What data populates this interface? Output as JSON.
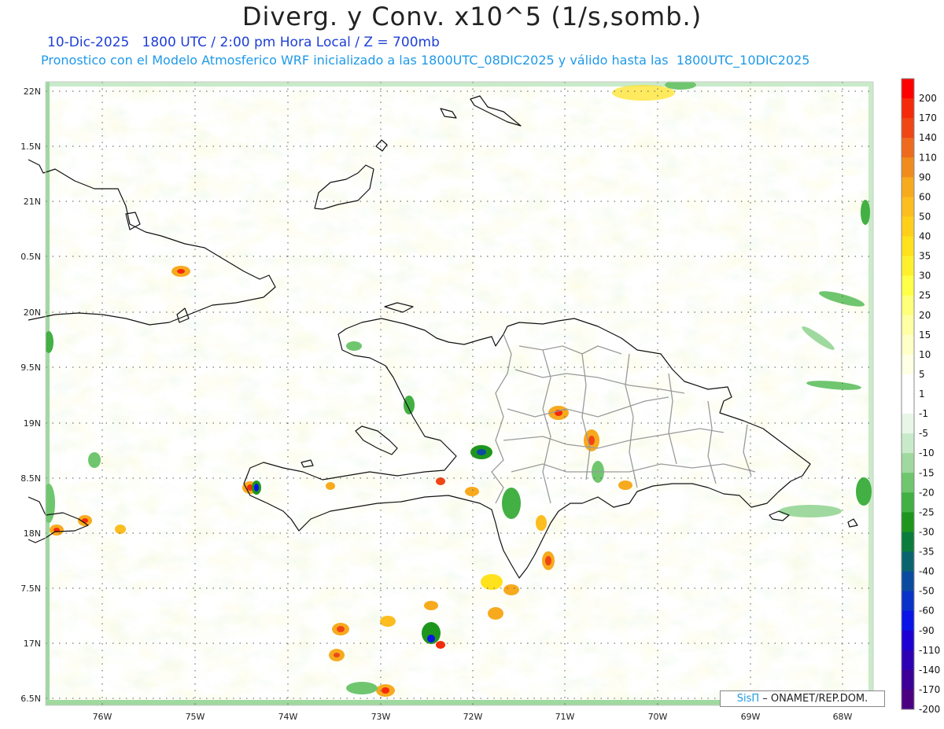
{
  "title": "Diverg. y Conv. x10^5 (1/s,somb.)",
  "subtitle1": "10-Dic-2025   1800 UTC / 2:00 pm Hora Local / Z = 700mb",
  "subtitle2": "Pronostico con el Modelo Atmosferico WRF inicializado a las 1800UTC_08DIC2025 y válido hasta las  1800UTC_10DIC2025",
  "credit": {
    "brand": "SisΠ",
    "text": "– ONAMET/REP.DOM."
  },
  "lat_labels": [
    "22N",
    "1.5N",
    "21N",
    "0.5N",
    "20N",
    "9.5N",
    "19N",
    "8.5N",
    "18N",
    "7.5N",
    "17N",
    "6.5N"
  ],
  "lon_labels": [
    "76W",
    "75W",
    "74W",
    "73W",
    "72W",
    "71W",
    "70W",
    "69W",
    "68W"
  ],
  "colorbar": {
    "labels": [
      "200",
      "170",
      "140",
      "110",
      "90",
      "60",
      "50",
      "40",
      "35",
      "30",
      "25",
      "20",
      "15",
      "10",
      "5",
      "1",
      "-1",
      "-5",
      "-10",
      "-15",
      "-20",
      "-25",
      "-30",
      "-35",
      "-40",
      "-50",
      "-60",
      "-90",
      "-110",
      "-140",
      "-170",
      "-200"
    ],
    "colors": [
      "#ff0000",
      "#f52a0a",
      "#f04514",
      "#ee6a1e",
      "#f08c1e",
      "#f7aa1e",
      "#fcbd1e",
      "#ffcf1a",
      "#ffe11c",
      "#fff02d",
      "#ffff48",
      "#ffff7a",
      "#ffffa4",
      "#ffffc8",
      "#ffffe6",
      "#ffffff",
      "#ffffff",
      "#e8f6e8",
      "#c9eac9",
      "#9fd99f",
      "#6fc66f",
      "#42b042",
      "#1e961e",
      "#0a7d3c",
      "#0a646e",
      "#0a4ba0",
      "#0a32c8",
      "#0a14e6",
      "#1e00d2",
      "#2d00b4",
      "#3c0096",
      "#4b0082"
    ]
  },
  "map_features": [
    "Cuba",
    "Haiti",
    "Republica Dominicana",
    "Jamaica",
    "Bahamas",
    "Isla de la Gonave",
    "Isla Saona",
    "Isla Mona"
  ]
}
